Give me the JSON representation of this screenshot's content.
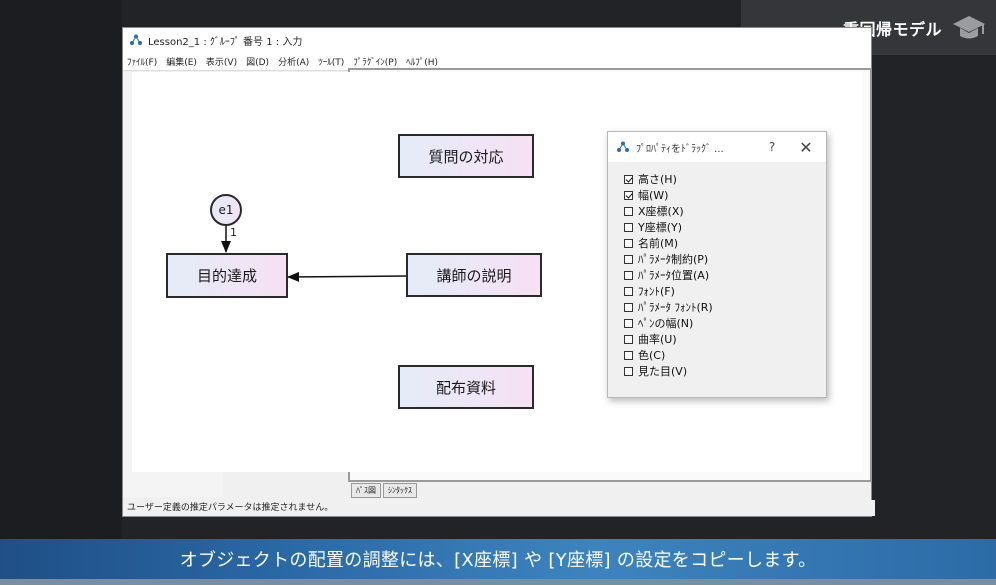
{
  "badge": {
    "label": "重回帰モデル",
    "icon": "graduation-cap-icon"
  },
  "app": {
    "title": "Lesson2_1 : ｸﾞﾙｰﾌﾟ 番号 1 : 入力",
    "menu": [
      "ﾌｧｲﾙ(F)",
      "編集(E)",
      "表示(V)",
      "図(D)",
      "分析(A)",
      "ﾂｰﾙ(T)",
      "ﾌﾟﾗｸﾞｲﾝ(P)",
      "ﾍﾙﾌﾟ(H)"
    ],
    "tabs": [
      "ﾊﾟｽ図",
      "ｼﾝﾀｯｸｽ"
    ],
    "status": "ユーザー定義の推定パラメータは推定されません。"
  },
  "diagram": {
    "nodes": {
      "question": "質問の対応",
      "goal": "目的達成",
      "explanation": "講師の説明",
      "handout": "配布資料"
    },
    "error": {
      "label": "e1",
      "weight": "1"
    }
  },
  "dialog": {
    "title": "ﾌﾟﾛﾊﾟﾃｨをﾄﾞﾗｯｸﾞ ...",
    "help": "?",
    "close": "✕",
    "options": [
      {
        "label": "高さ(H)",
        "checked": true
      },
      {
        "label": "幅(W)",
        "checked": true
      },
      {
        "label": "X座標(X)",
        "checked": false
      },
      {
        "label": "Y座標(Y)",
        "checked": false
      },
      {
        "label": "名前(M)",
        "checked": false
      },
      {
        "label": "ﾊﾟﾗﾒｰﾀ制約(P)",
        "checked": false
      },
      {
        "label": "ﾊﾟﾗﾒｰﾀ位置(A)",
        "checked": false
      },
      {
        "label": "ﾌｫﾝﾄ(F)",
        "checked": false
      },
      {
        "label": "ﾊﾟﾗﾒｰﾀ ﾌｫﾝﾄ(R)",
        "checked": false
      },
      {
        "label": "ﾍﾟﾝの幅(N)",
        "checked": false
      },
      {
        "label": "曲率(U)",
        "checked": false
      },
      {
        "label": "色(C)",
        "checked": false
      },
      {
        "label": "見た目(V)",
        "checked": false
      }
    ]
  },
  "subtitle": "オブジェクトの配置の調整には、[X座標] や [Y座標] の設定をコピーします。"
}
